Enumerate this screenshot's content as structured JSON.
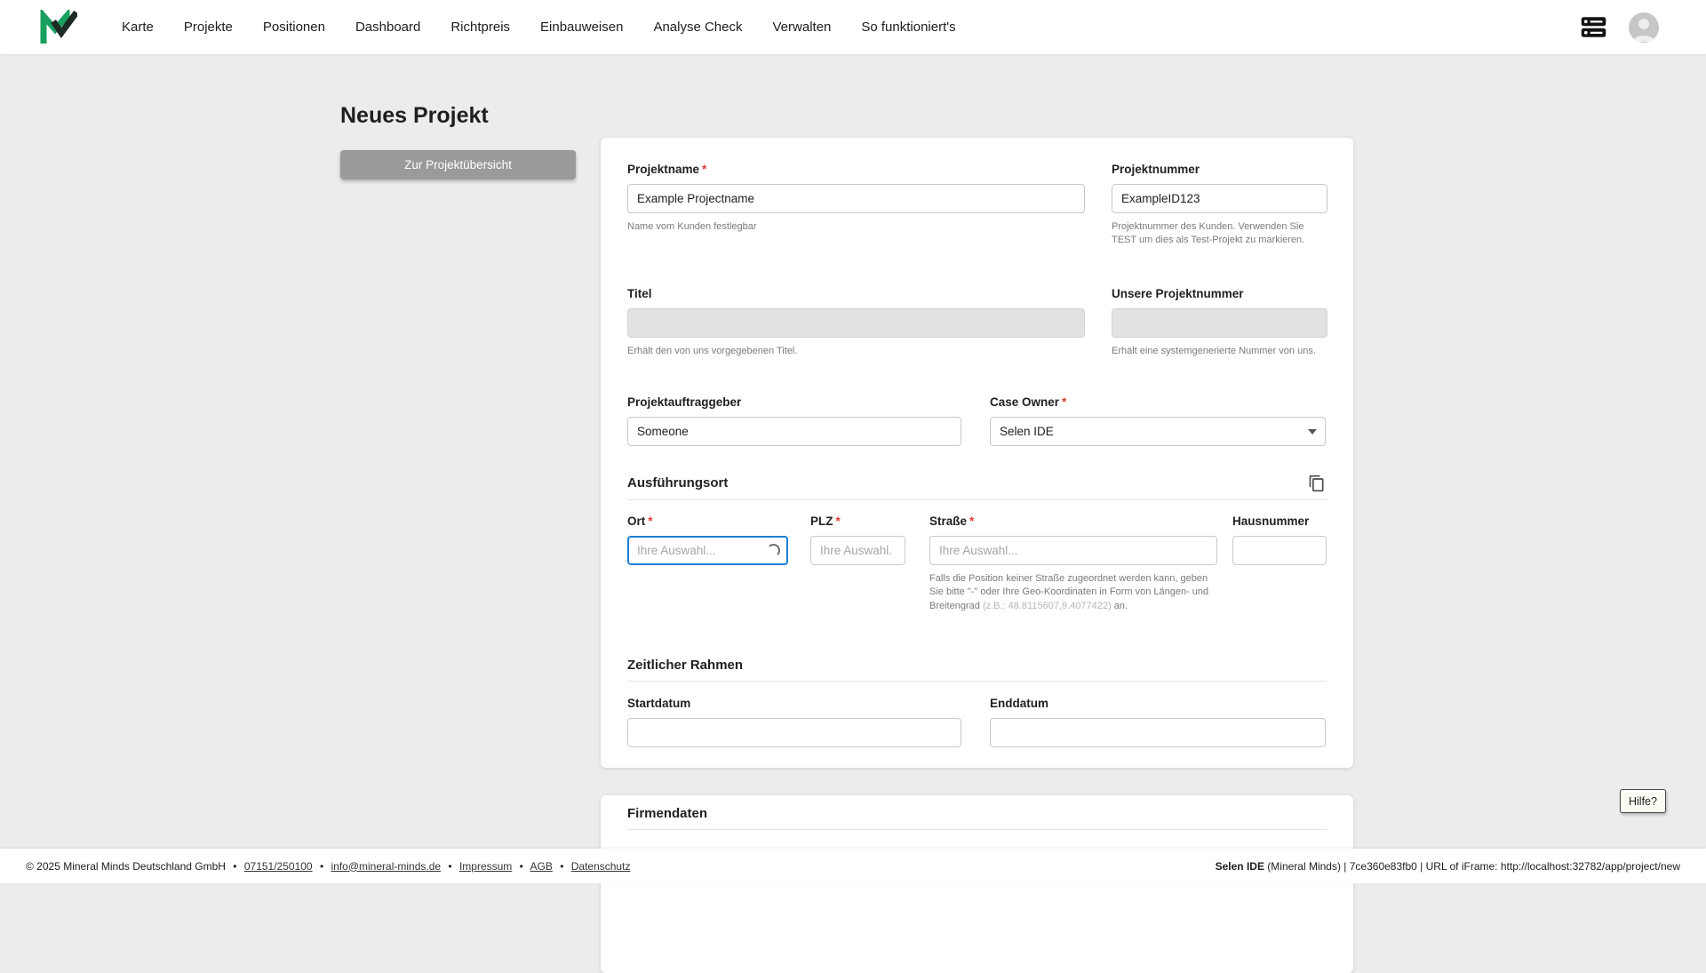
{
  "theme": {
    "brand_green": "#18a05e",
    "required_red": "#e53935",
    "focus_blue": "#1c7fd6",
    "page_background": "#ececec",
    "disabled_field": "#e2e2e2"
  },
  "icons": {
    "logo": "mineral-minds-logo",
    "server": "server-icon",
    "avatar": "user-avatar-icon",
    "copy": "copy-icon",
    "caret": "chevron-down-icon",
    "spinner": "loading-spinner-icon"
  },
  "navbar": {
    "items": [
      {
        "label": "Karte"
      },
      {
        "label": "Projekte"
      },
      {
        "label": "Positionen"
      },
      {
        "label": "Dashboard"
      },
      {
        "label": "Richtpreis"
      },
      {
        "label": "Einbauweisen"
      },
      {
        "label": "Analyse Check"
      },
      {
        "label": "Verwalten"
      },
      {
        "label": "So funktioniert's"
      }
    ]
  },
  "page": {
    "title": "Neues Projekt",
    "overview_button": "Zur Projektübersicht",
    "help_button": "Hilfe?"
  },
  "form": {
    "projektname": {
      "label": "Projektname",
      "required": "*",
      "value": "Example Projectname",
      "helper": "Name vom Kunden festlegbar"
    },
    "projektnummer": {
      "label": "Projektnummer",
      "value": "ExampleID123",
      "helper": "Projektnummer des Kunden. Verwenden Sie TEST um dies als Test-Projekt zu markieren."
    },
    "titel": {
      "label": "Titel",
      "value": "",
      "helper": "Erhält den von uns vorgegebenen Titel."
    },
    "unsere_projektnummer": {
      "label": "Unsere Projektnummer",
      "value": "",
      "helper": "Erhält eine systemgenerierte Nummer von uns."
    },
    "projektauftraggeber": {
      "label": "Projektauftraggeber",
      "value": "Someone"
    },
    "case_owner": {
      "label": "Case Owner",
      "required": "*",
      "value": "Selen IDE"
    },
    "ausfuehrungsort": {
      "heading": "Ausführungsort",
      "ort": {
        "label": "Ort",
        "required": "*",
        "placeholder": "Ihre Auswahl...",
        "value": ""
      },
      "plz": {
        "label": "PLZ",
        "required": "*",
        "placeholder": "Ihre Auswahl.",
        "value": ""
      },
      "strasse": {
        "label": "Straße",
        "required": "*",
        "placeholder": "Ihre Auswahl...",
        "value": "",
        "helper_main": "Falls die Position keiner Straße zugeordnet werden kann, geben Sie bitte \"-\" oder Ihre Geo-Koordinaten in Form von Längen- und Breitengrad ",
        "helper_example": "(z.B.: 48.8115607,9.4077422)",
        "helper_end": " an."
      },
      "hausnummer": {
        "label": "Hausnummer",
        "value": ""
      }
    },
    "zeitlicher_rahmen": {
      "heading": "Zeitlicher Rahmen",
      "startdatum": {
        "label": "Startdatum",
        "value": ""
      },
      "enddatum": {
        "label": "Enddatum",
        "value": ""
      }
    },
    "firmendaten": {
      "heading": "Firmendaten"
    }
  },
  "footer": {
    "copyright": "© 2025 Mineral Minds Deutschland GmbH",
    "separator": "•",
    "links": [
      {
        "label": "07151/250100"
      },
      {
        "label": "info@mineral-minds.de"
      },
      {
        "label": "Impressum"
      },
      {
        "label": "AGB"
      },
      {
        "label": "Datenschutz"
      }
    ],
    "session_user": "Selen IDE",
    "session_rest": " (Mineral Minds) | 7ce360e83fb0 | URL of iFrame: http://localhost:32782/app/project/new"
  }
}
